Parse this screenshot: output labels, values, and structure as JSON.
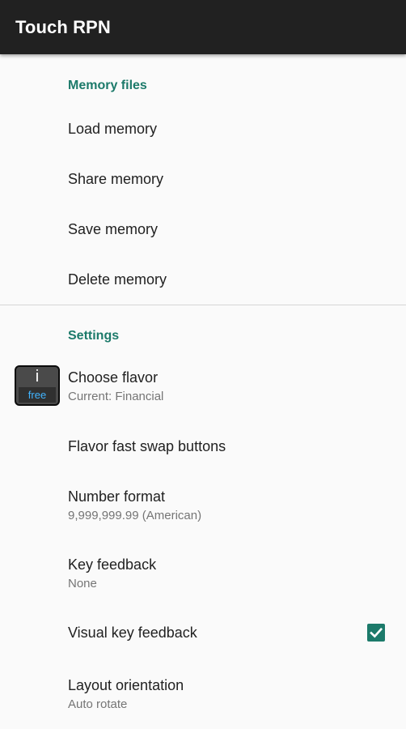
{
  "app_title": "Touch RPN",
  "memory_section": {
    "header": "Memory files",
    "items": [
      {
        "title": "Load memory"
      },
      {
        "title": "Share memory"
      },
      {
        "title": "Save memory"
      },
      {
        "title": "Delete memory"
      }
    ]
  },
  "settings_section": {
    "header": "Settings",
    "flavor_icon": {
      "glyph": "i",
      "badge": "free"
    },
    "items": [
      {
        "title": "Choose flavor",
        "summary": "Current: Financial"
      },
      {
        "title": "Flavor fast swap buttons"
      },
      {
        "title": "Number format",
        "summary": "9,999,999.99 (American)"
      },
      {
        "title": "Key feedback",
        "summary": "None"
      },
      {
        "title": "Visual key feedback",
        "checked": true
      },
      {
        "title": "Layout orientation",
        "summary": "Auto rotate"
      }
    ]
  },
  "colors": {
    "accent": "#1c7a6a",
    "toolbar": "#212121",
    "background": "#fafafa"
  }
}
